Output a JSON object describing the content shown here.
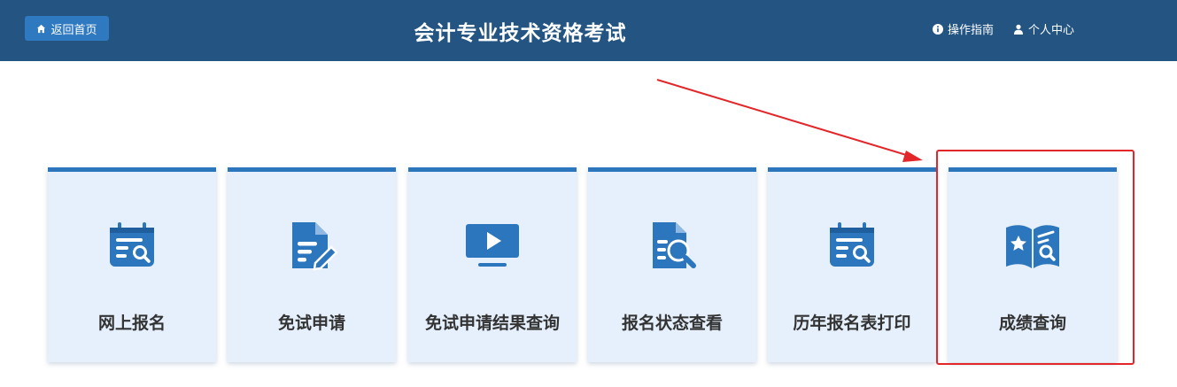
{
  "header": {
    "home_label": "返回首页",
    "title": "会计专业技术资格考试",
    "guide_label": "操作指南",
    "user_center_label": "个人中心"
  },
  "cards": [
    {
      "label": "网上报名",
      "icon": "calendar-search-icon"
    },
    {
      "label": "免试申请",
      "icon": "document-edit-icon"
    },
    {
      "label": "免试申请结果查询",
      "icon": "video-play-icon"
    },
    {
      "label": "报名状态查看",
      "icon": "document-search-icon"
    },
    {
      "label": "历年报名表打印",
      "icon": "calendar-search-icon"
    },
    {
      "label": "成绩查询",
      "icon": "book-star-search-icon"
    }
  ],
  "colors": {
    "header_bg": "#235482",
    "accent": "#2b76bd",
    "card_bg": "#e5f0fc",
    "annotation": "#e2262a"
  }
}
